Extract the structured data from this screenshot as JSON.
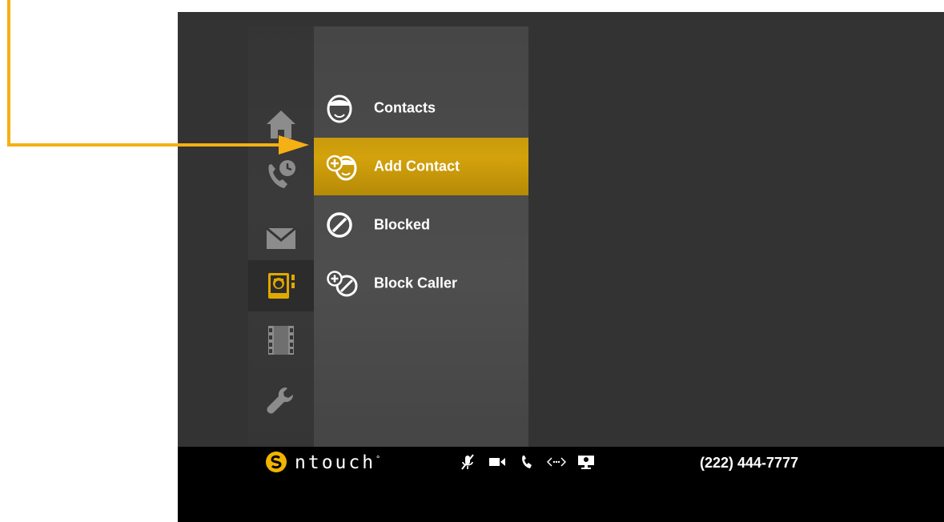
{
  "app": {
    "brand": "ntouch",
    "phone_number": "(222) 444-7777"
  },
  "sidebar": {
    "items": [
      {
        "name": "home",
        "icon": "home-icon"
      },
      {
        "name": "call-history",
        "icon": "call-history-icon"
      },
      {
        "name": "messages",
        "icon": "envelope-icon"
      },
      {
        "name": "contacts",
        "icon": "contacts-book-icon",
        "active": true
      },
      {
        "name": "videos",
        "icon": "film-icon"
      },
      {
        "name": "settings",
        "icon": "wrench-icon"
      }
    ]
  },
  "submenu": {
    "items": [
      {
        "label": "Contacts",
        "icon": "contact-face-icon"
      },
      {
        "label": "Add Contact",
        "icon": "add-contact-icon",
        "selected": true
      },
      {
        "label": "Blocked",
        "icon": "blocked-icon"
      },
      {
        "label": "Block Caller",
        "icon": "block-caller-icon"
      }
    ]
  },
  "statusbar": {
    "icons": [
      "mic-muted-icon",
      "video-camera-icon",
      "phone-icon",
      "connection-icon",
      "screen-share-icon"
    ]
  },
  "colors": {
    "accent": "#d3a20c",
    "callout": "#f5b013",
    "background": "#333333",
    "active_icon": "#e0a800"
  }
}
